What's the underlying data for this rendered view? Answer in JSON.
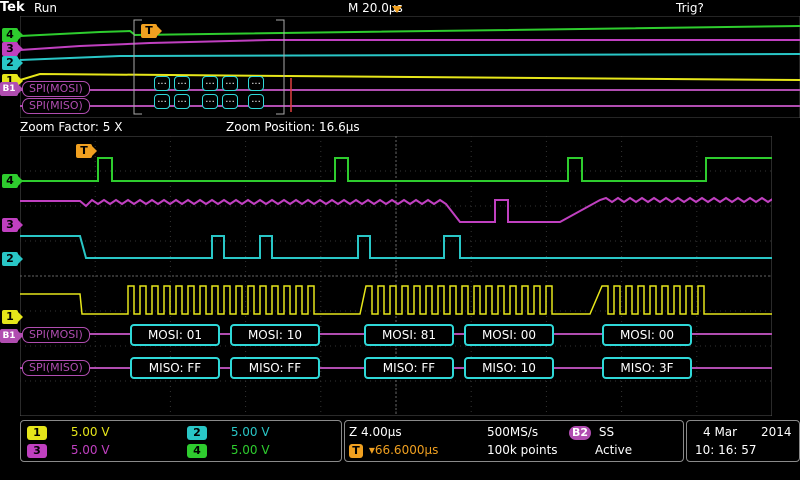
{
  "header": {
    "brand": "Tek",
    "run_state": "Run",
    "timebase": "M 20.0µs",
    "trigger_state": "Trig?"
  },
  "zoom_info": {
    "zoom_factor": "Zoom Factor: 5 X",
    "zoom_position": "Zoom Position: 16.6µs"
  },
  "channels": [
    {
      "id": "4",
      "color": "#2ecc2e"
    },
    {
      "id": "3",
      "color": "#c040c0"
    },
    {
      "id": "2",
      "color": "#29c6c6"
    },
    {
      "id": "1",
      "color": "#e6e61a"
    }
  ],
  "bus_labels": {
    "b1": "B1",
    "mosi": "SPI(MOSI)",
    "miso": "SPI(MISO)"
  },
  "trigger_marker": "T",
  "decode_mosi": [
    "MOSI: 01",
    "MOSI: 10",
    "MOSI: 81",
    "MOSI: 00",
    "MOSI: 00"
  ],
  "decode_miso": [
    "MISO: FF",
    "MISO: FF",
    "MISO: FF",
    "MISO: 10",
    "MISO: 3F"
  ],
  "overview_decode": [
    "...",
    "...",
    "...",
    "...",
    "..."
  ],
  "status": {
    "ch1_num": "1",
    "ch1_scale": "5.00 V",
    "ch2_num": "2",
    "ch2_scale": "5.00 V",
    "ch3_num": "3",
    "ch3_scale": "5.00 V",
    "ch4_num": "4",
    "ch4_scale": "5.00 V",
    "zoom_scale": "Z 4.00µs",
    "sample_rate": "500MS/s",
    "record_length": "100k points",
    "trigger_pos": "▾66.6000µs",
    "bus_num": "B2",
    "bus_type": "SS",
    "bus_state": "Active",
    "date": "4 Mar",
    "year": "2014",
    "time": "10: 16: 57"
  },
  "colors": {
    "ch1": "#e6e61a",
    "ch2": "#29c6c6",
    "ch3": "#c040c0",
    "ch4": "#2ecc2e",
    "bus": "#b04db0",
    "trigger": "#f0a020",
    "accent": "#2fd8d8"
  }
}
